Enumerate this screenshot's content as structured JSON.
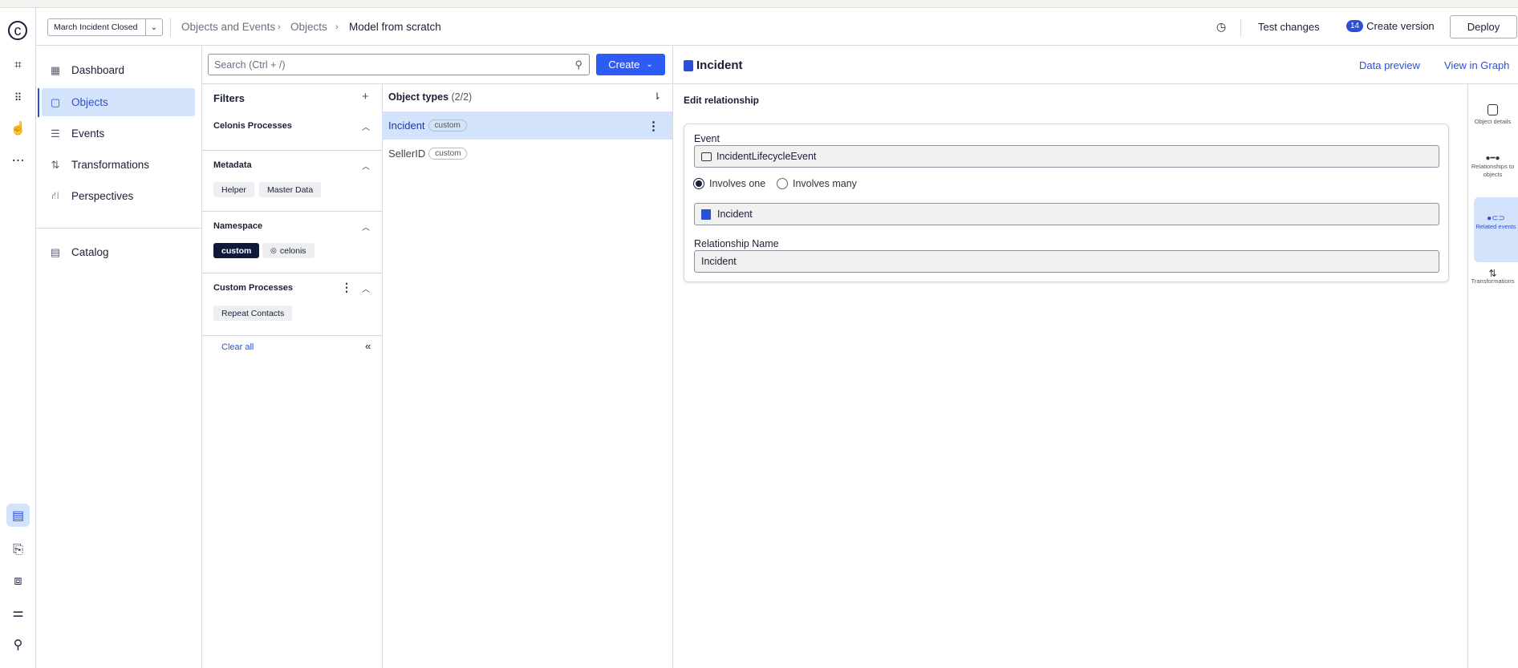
{
  "header": {
    "model_select": "March Incident Closed",
    "breadcrumb": [
      "Objects and Events",
      "Objects",
      "Model from scratch"
    ],
    "test_changes": "Test changes",
    "version_count": "14",
    "create_version": "Create version",
    "deploy": "Deploy"
  },
  "nav": {
    "items": [
      {
        "label": "Dashboard"
      },
      {
        "label": "Objects"
      },
      {
        "label": "Events"
      },
      {
        "label": "Transformations"
      },
      {
        "label": "Perspectives"
      }
    ],
    "catalog": "Catalog"
  },
  "search": {
    "placeholder": "Search (Ctrl + /)",
    "create": "Create"
  },
  "filters": {
    "title": "Filters",
    "sections": [
      {
        "title": "Celonis Processes"
      },
      {
        "title": "Metadata",
        "chips": [
          "Helper",
          "Master Data"
        ]
      },
      {
        "title": "Namespace",
        "chips": [
          "custom",
          "celonis"
        ]
      },
      {
        "title": "Custom Processes",
        "chips": [
          "Repeat Contacts"
        ]
      }
    ],
    "clear_all": "Clear all"
  },
  "object_types": {
    "title": "Object types",
    "count": "(2/2)",
    "items": [
      {
        "name": "Incident",
        "tag": "custom"
      },
      {
        "name": "SellerID",
        "tag": "custom"
      }
    ]
  },
  "detail": {
    "title": "Incident",
    "data_preview": "Data preview",
    "view_in_graph": "View in Graph",
    "section": "Edit relationship",
    "event_label": "Event",
    "event_value": "IncidentLifecycleEvent",
    "radio_one": "Involves one",
    "radio_many": "Involves many",
    "object_value": "Incident",
    "rel_name_label": "Relationship Name",
    "rel_name_value": "Incident"
  },
  "right_rail": {
    "items": [
      "Object details",
      "Relationships to objects",
      "Related events",
      "Transformations"
    ]
  },
  "colors": {
    "accent": "#2d4fd7",
    "selected_bg": "#d3e3fb"
  }
}
